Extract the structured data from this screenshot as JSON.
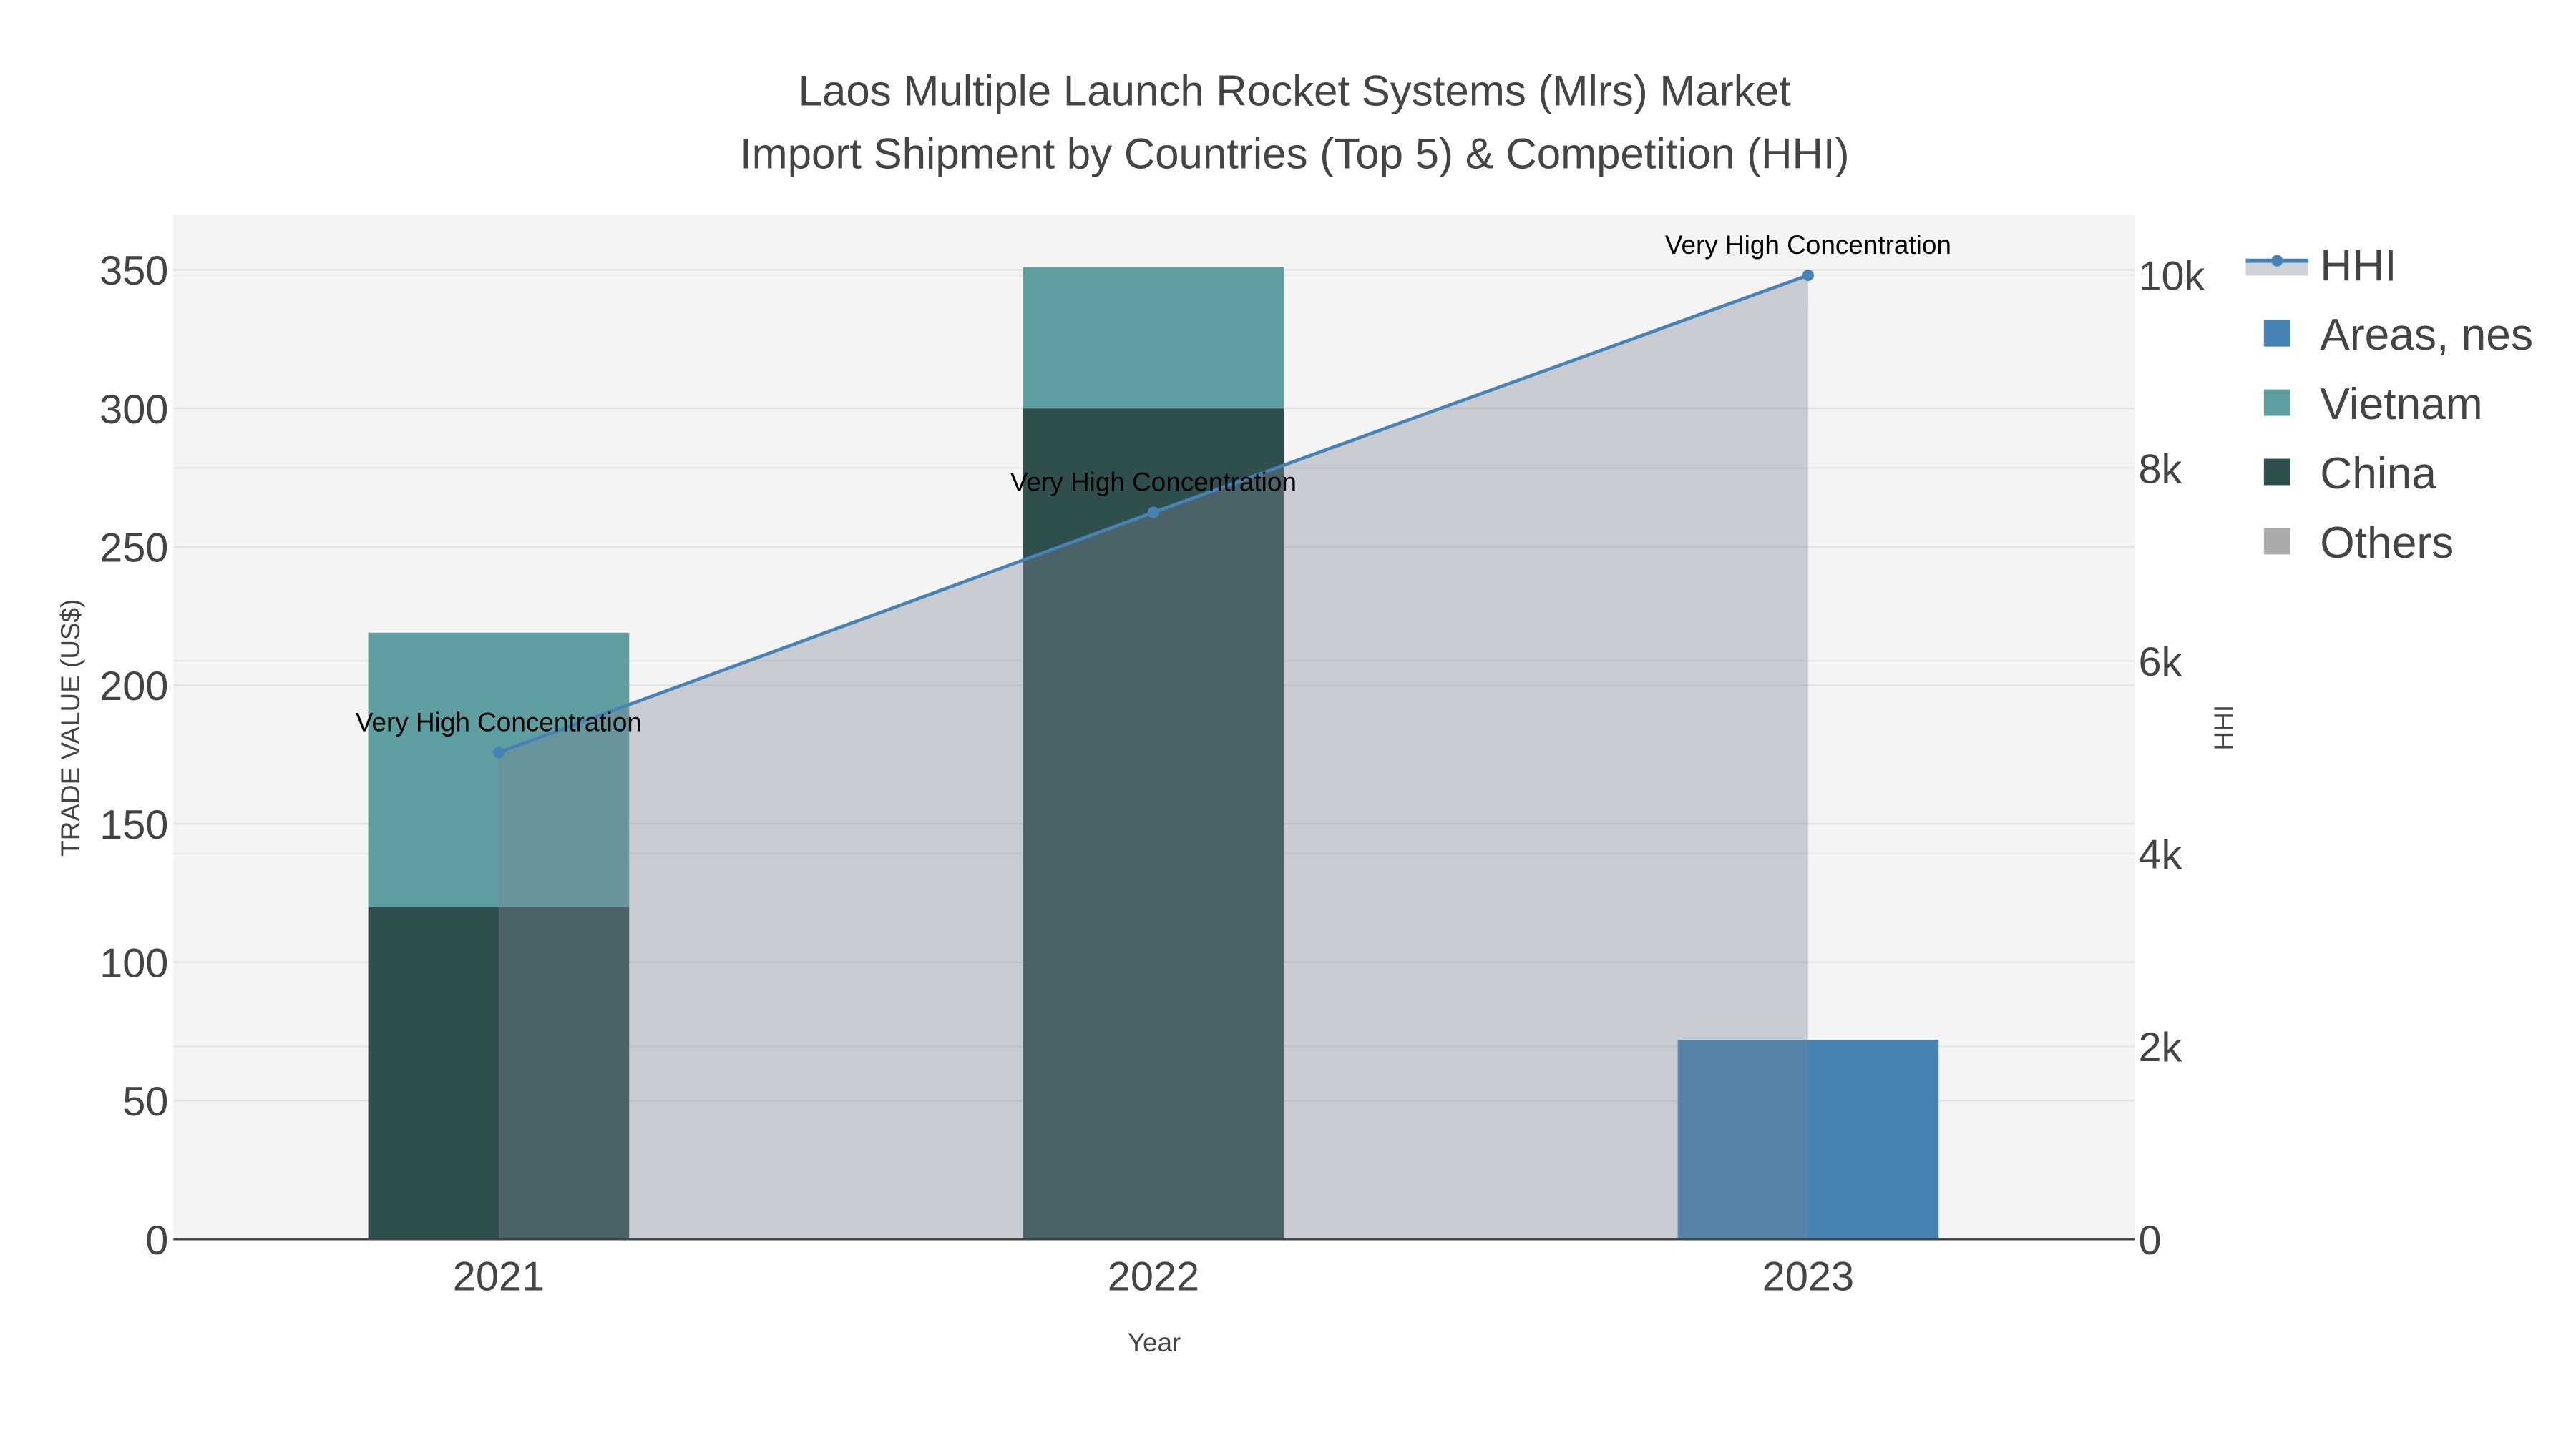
{
  "chart_data": {
    "type": "bar",
    "title_lines": [
      "Laos Multiple Launch Rocket Systems (Mlrs) Market",
      "Import Shipment by Countries (Top 5) & Competition (HHI)"
    ],
    "xlabel": "Year",
    "ylabel": "TRADE VALUE (US$)",
    "y2label": "HHI",
    "categories": [
      "2021",
      "2022",
      "2023"
    ],
    "ylim": [
      0,
      370
    ],
    "y2lim": [
      0,
      10630
    ],
    "yticks": [
      0,
      50,
      100,
      150,
      200,
      250,
      300,
      350
    ],
    "y2ticks": [
      0,
      2000,
      4000,
      6000,
      8000,
      10000
    ],
    "y2ticklabels": [
      "0",
      "2k",
      "4k",
      "6k",
      "8k",
      "10k"
    ],
    "barmode": "stack",
    "series": [
      {
        "name": "Others",
        "color": "#aaaaaa",
        "values": [
          0,
          0,
          0
        ]
      },
      {
        "name": "China",
        "color": "#2f4f4f",
        "values": [
          120,
          300,
          0
        ]
      },
      {
        "name": "Vietnam",
        "color": "#5f9ea0",
        "values": [
          99,
          51,
          0
        ]
      },
      {
        "name": "Areas, nes",
        "color": "#4682b4",
        "values": [
          0,
          0,
          72
        ]
      }
    ],
    "hhi": {
      "name": "HHI",
      "color": "#4682b4",
      "values": [
        5050,
        7540,
        10000
      ],
      "annotations": [
        "Very High Concentration",
        "Very High Concentration",
        "Very High Concentration"
      ]
    },
    "legend_order": [
      "HHI",
      "Areas, nes",
      "Vietnam",
      "China",
      "Others"
    ],
    "legend": "right",
    "grid": true
  }
}
